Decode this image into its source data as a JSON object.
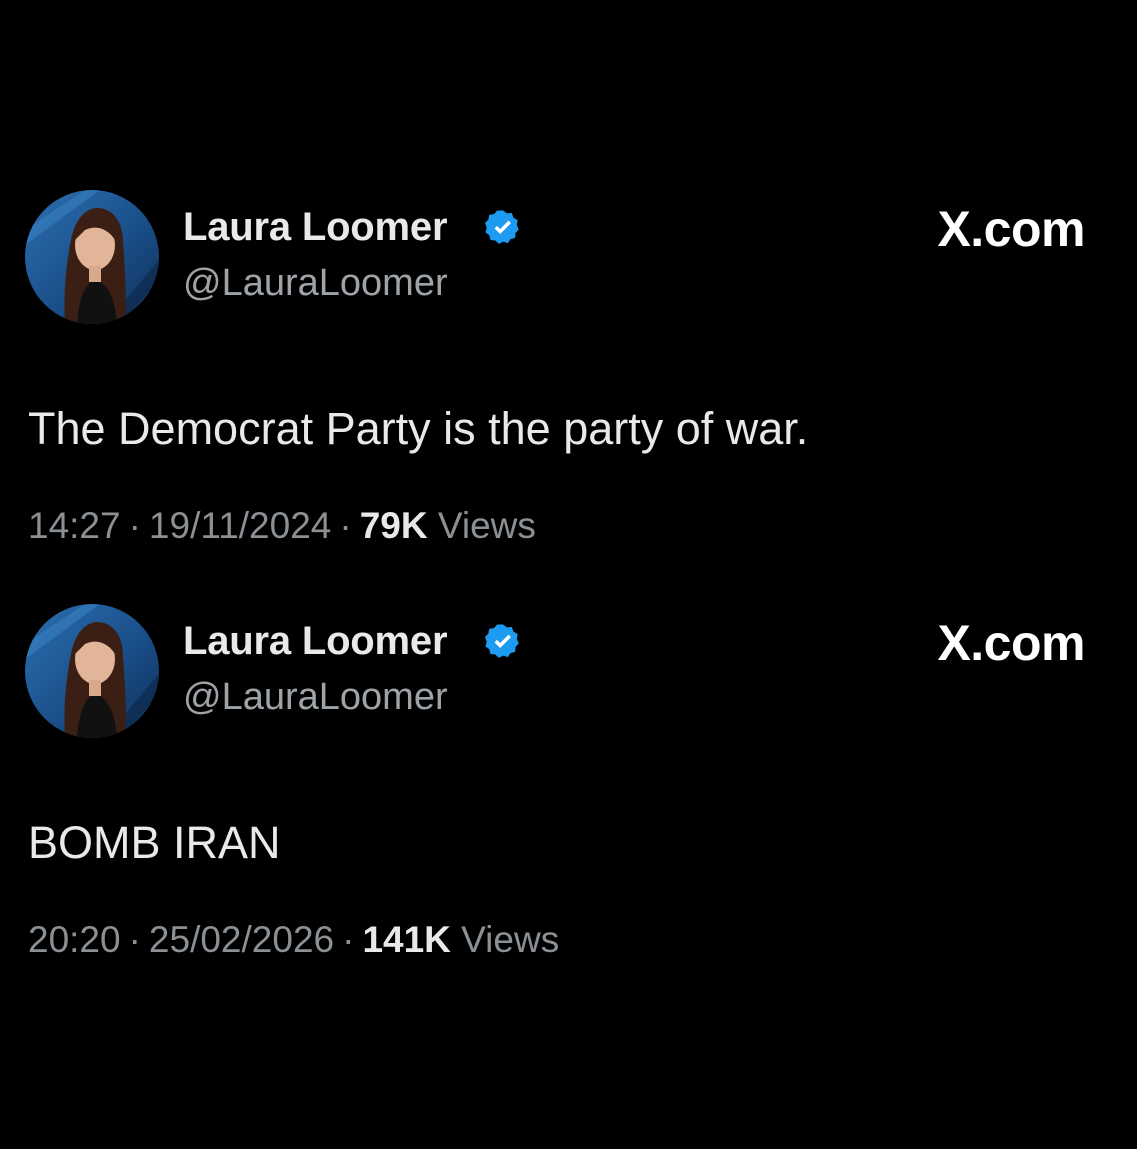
{
  "posts": [
    {
      "author": {
        "display_name": "Laura Loomer",
        "handle": "@LauraLoomer",
        "verified": true,
        "avatar_icon": "profile-photo"
      },
      "site_label": "X.com",
      "text": "The Democrat Party is the party of war.",
      "time": "14:27",
      "date": "19/11/2024",
      "separator": "·",
      "views_count": "79K",
      "views_label": "Views"
    },
    {
      "author": {
        "display_name": "Laura Loomer",
        "handle": "@LauraLoomer",
        "verified": true,
        "avatar_icon": "profile-photo"
      },
      "site_label": "X.com",
      "text": "BOMB IRAN",
      "time": "20:20",
      "date": "25/02/2026",
      "separator": "·",
      "views_count": "141K",
      "views_label": "Views"
    }
  ],
  "colors": {
    "background": "#000000",
    "text_primary": "#e7e9ea",
    "text_secondary": "#8b9095",
    "verified_badge": "#1d9bf0"
  }
}
